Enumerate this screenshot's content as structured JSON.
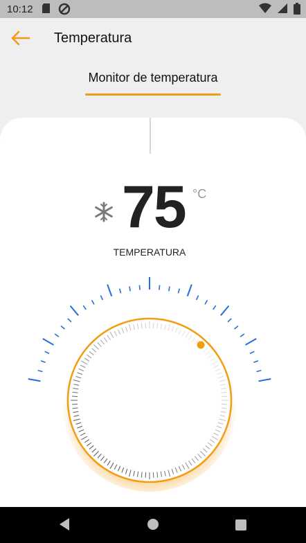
{
  "status_bar": {
    "time": "10:12",
    "icons": [
      "sd-card-icon",
      "do-not-disturb-icon",
      "wifi-icon",
      "signal-icon",
      "battery-icon"
    ]
  },
  "app_bar": {
    "back_icon": "arrow-left-icon",
    "title": "Temperatura"
  },
  "tabs": [
    {
      "label": "Monitor de temperatura",
      "active": true
    }
  ],
  "temperature": {
    "value": "75",
    "unit": "°C",
    "label": "TEMPERATURA",
    "mode_icon": "snowflake-icon"
  },
  "colors": {
    "accent": "#f39c12",
    "tick_blue": "#1e6fe0",
    "card": "#ffffff",
    "background": "#efefef"
  },
  "nav_bar": {
    "icons": [
      "nav-back-icon",
      "nav-home-icon",
      "nav-recents-icon"
    ]
  }
}
